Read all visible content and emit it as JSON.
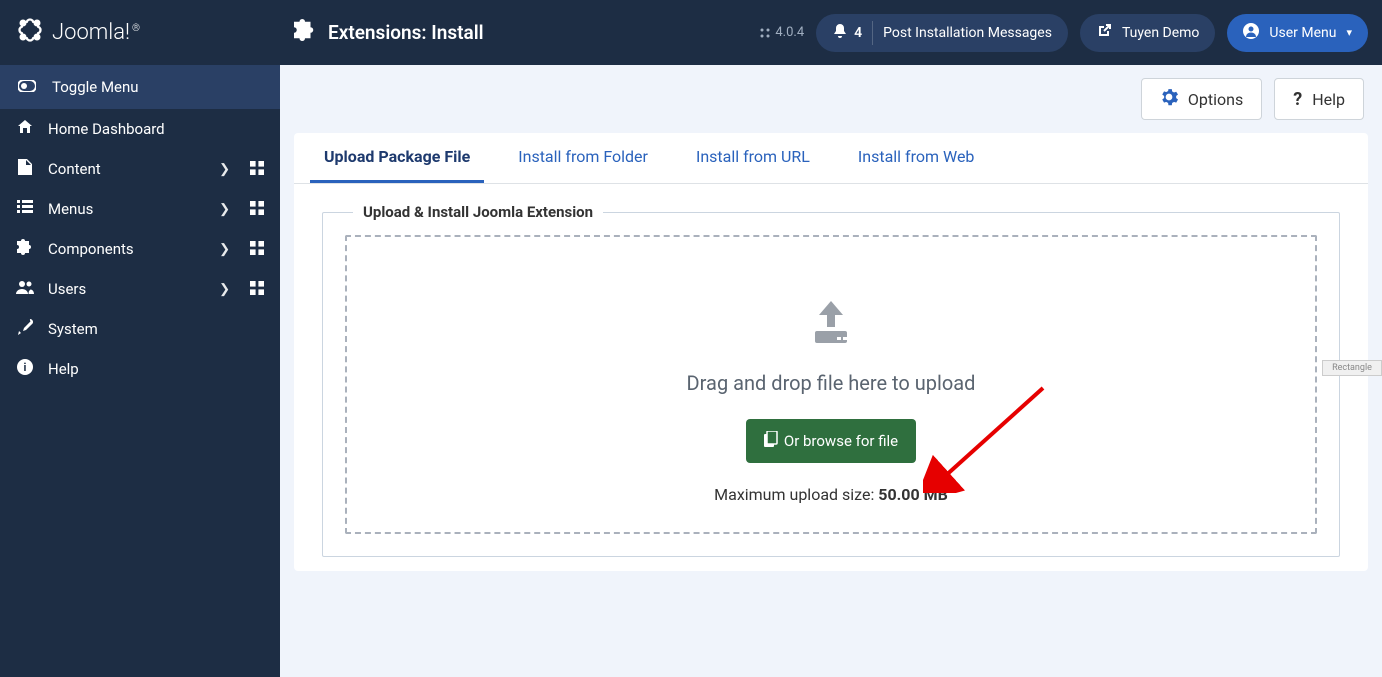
{
  "brand": "Joomla!",
  "page_title": "Extensions: Install",
  "version_label": "4.0.4",
  "header": {
    "notif_count": "4",
    "notif_label": "Post Installation Messages",
    "site_name": "Tuyen Demo",
    "user_menu": "User Menu"
  },
  "sidebar": {
    "toggle": "Toggle Menu",
    "items": [
      {
        "label": "Home Dashboard",
        "has_sub": false,
        "has_grid": false
      },
      {
        "label": "Content",
        "has_sub": true,
        "has_grid": true
      },
      {
        "label": "Menus",
        "has_sub": true,
        "has_grid": true
      },
      {
        "label": "Components",
        "has_sub": true,
        "has_grid": true
      },
      {
        "label": "Users",
        "has_sub": true,
        "has_grid": true
      },
      {
        "label": "System",
        "has_sub": false,
        "has_grid": false
      },
      {
        "label": "Help",
        "has_sub": false,
        "has_grid": false
      }
    ]
  },
  "toolbar": {
    "options": "Options",
    "help": "Help"
  },
  "tabs": [
    {
      "label": "Upload Package File",
      "active": true
    },
    {
      "label": "Install from Folder",
      "active": false
    },
    {
      "label": "Install from URL",
      "active": false
    },
    {
      "label": "Install from Web",
      "active": false
    }
  ],
  "upload": {
    "legend": "Upload & Install Joomla Extension",
    "dnd_text": "Drag and drop file here to upload",
    "browse_label": "Or browse for file",
    "max_prefix": "Maximum upload size: ",
    "max_value": "50.00 MB"
  },
  "rect_badge": "Rectangle"
}
